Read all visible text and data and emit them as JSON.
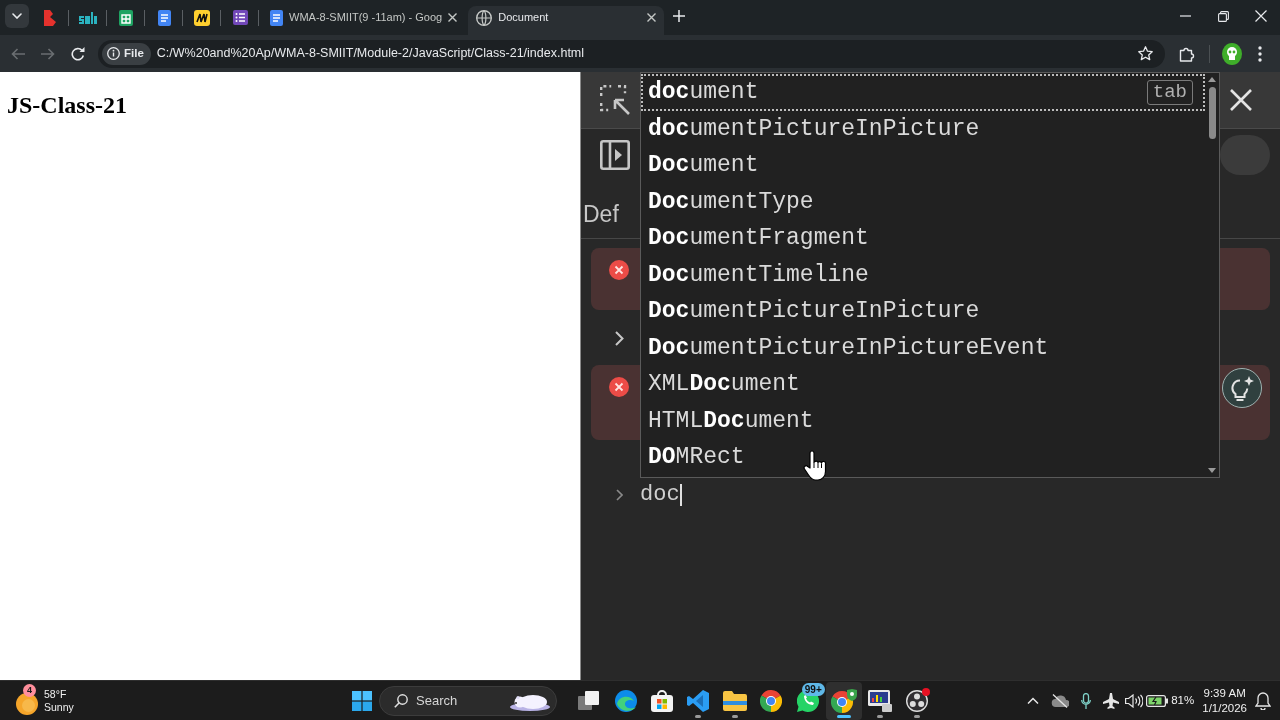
{
  "browser": {
    "tabs": [
      {
        "kind": "pinned",
        "selected": false
      },
      {
        "kind": "pinned",
        "selected": false
      },
      {
        "kind": "pinned",
        "selected": false
      },
      {
        "kind": "pinned",
        "selected": false
      },
      {
        "kind": "pinned",
        "selected": false
      },
      {
        "kind": "pinned",
        "selected": false
      },
      {
        "kind": "normal",
        "title": "WMA-8-SMIIT(9 -11am) - Goog",
        "selected": false
      },
      {
        "kind": "normal",
        "title": "Document",
        "selected": true
      }
    ],
    "nav": [
      {
        "kind": "back",
        "disabled": true
      },
      {
        "kind": "forward",
        "disabled": true
      },
      {
        "kind": "reload",
        "disabled": false
      }
    ],
    "address": {
      "chip": "File",
      "url": "C:/W%20and%20Ap/WMA-8-SMIIT/Module-2/JavaScript/Class-21/index.html"
    }
  },
  "page": {
    "heading": "JS-Class-21"
  },
  "devtools": {
    "toolbar_label": "Def",
    "messages": [
      {
        "kind": "error"
      },
      {
        "kind": "group",
        "expanded": false
      },
      {
        "kind": "error"
      }
    ],
    "prompt": {
      "value": "doc"
    },
    "autocomplete": {
      "hint": "tab",
      "items": [
        {
          "text": "**doc**ument",
          "selected": true
        },
        {
          "text": "**doc**umentPictureInPicture",
          "selected": false
        },
        {
          "text": "**Doc**ument",
          "selected": false
        },
        {
          "text": "**Doc**umentType",
          "selected": false
        },
        {
          "text": "**Doc**umentFragment",
          "selected": false
        },
        {
          "text": "**Doc**umentTimeline",
          "selected": false
        },
        {
          "text": "**Doc**umentPictureInPicture",
          "selected": false
        },
        {
          "text": "**Doc**umentPictureInPictureEvent",
          "selected": false
        },
        {
          "text": "XML**Doc**ument",
          "selected": false
        },
        {
          "text": "HTML**Doc**ument",
          "selected": false
        },
        {
          "text": "**DO**MRect",
          "selected": false
        }
      ]
    }
  },
  "taskbar": {
    "weather": {
      "badge": "4",
      "temperature": "58°F",
      "condition": "Sunny"
    },
    "search": {
      "placeholder": "Search"
    },
    "apps": [
      {
        "running": false,
        "selected": false,
        "alert": false
      },
      {
        "running": false,
        "selected": false,
        "alert": false
      },
      {
        "running": false,
        "selected": false,
        "alert": false
      },
      {
        "running": true,
        "selected": false,
        "alert": false
      },
      {
        "running": true,
        "selected": false,
        "alert": false
      },
      {
        "running": false,
        "selected": false,
        "alert": false
      },
      {
        "running": false,
        "selected": false,
        "alert": false,
        "badge": "99+"
      },
      {
        "running": true,
        "selected": true,
        "alert": false
      },
      {
        "running": true,
        "selected": false,
        "alert": false
      },
      {
        "running": true,
        "selected": false,
        "alert": true
      }
    ],
    "tray": {
      "battery": "81%",
      "time": "9:39 AM",
      "date": "1/1/2026"
    }
  }
}
